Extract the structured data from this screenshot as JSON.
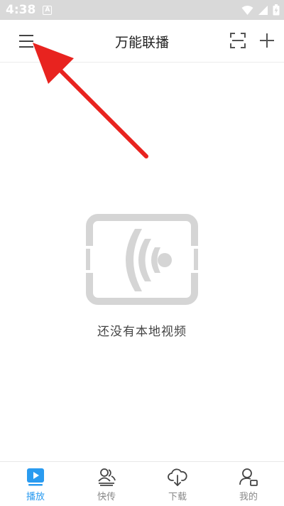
{
  "status_bar": {
    "time": "4:38",
    "notification_letter": "A"
  },
  "header": {
    "title": "万能联播"
  },
  "empty_state": {
    "message": "还没有本地视频"
  },
  "tabs": [
    {
      "label": "播放",
      "icon": "play-icon",
      "active": true
    },
    {
      "label": "快传",
      "icon": "transfer-users-icon",
      "active": false
    },
    {
      "label": "下载",
      "icon": "cloud-download-icon",
      "active": false
    },
    {
      "label": "我的",
      "icon": "profile-icon",
      "active": false
    }
  ],
  "colors": {
    "accent": "#2a9bf0",
    "arrow": "#e8231f",
    "illustration": "#d5d5d5",
    "status_bar": "#d9d9d9"
  }
}
